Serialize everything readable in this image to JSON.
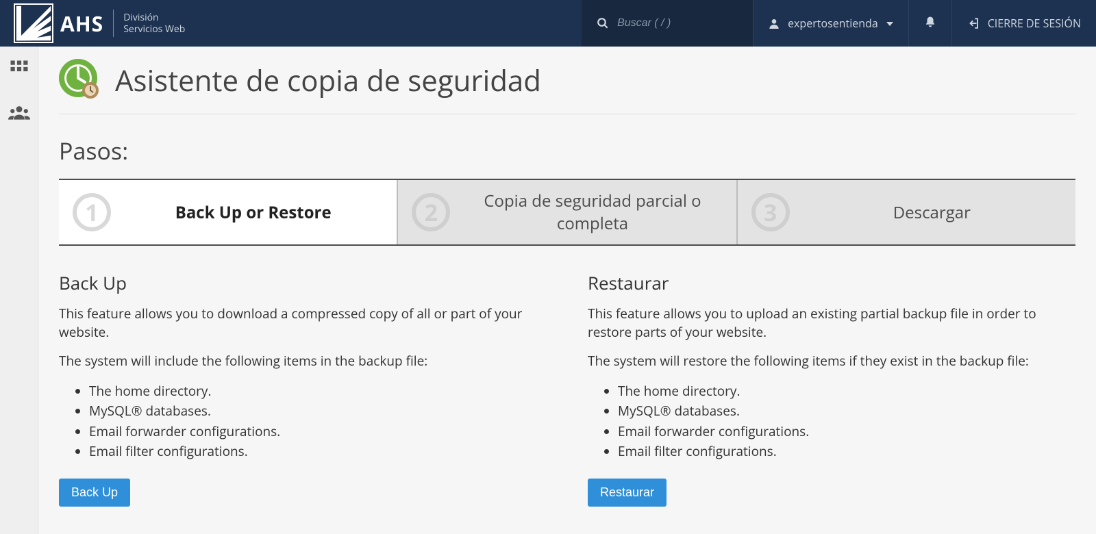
{
  "brand": {
    "main": "AHS",
    "sub1": "División",
    "sub2": "Servicios Web"
  },
  "nav": {
    "search_placeholder": "Buscar ( / )",
    "user": "expertosentienda",
    "logout": "CIERRE DE SESIÓN"
  },
  "page": {
    "title": "Asistente de copia de seguridad",
    "steps_heading": "Pasos:"
  },
  "steps": [
    {
      "num": "1",
      "label": "Back Up or Restore",
      "active": true
    },
    {
      "num": "2",
      "label": "Copia de seguridad parcial o completa",
      "active": false
    },
    {
      "num": "3",
      "label": "Descargar",
      "active": false
    }
  ],
  "backup": {
    "heading": "Back Up",
    "desc": "This feature allows you to download a compressed copy of all or part of your website.",
    "list_intro": "The system will include the following items in the backup file:",
    "items": [
      "The home directory.",
      "MySQL® databases.",
      "Email forwarder configurations.",
      "Email filter configurations."
    ],
    "button": "Back Up"
  },
  "restore": {
    "heading": "Restaurar",
    "desc": "This feature allows you to upload an existing partial backup file in order to restore parts of your website.",
    "list_intro": "The system will restore the following items if they exist in the backup file:",
    "items": [
      "The home directory.",
      "MySQL® databases.",
      "Email forwarder configurations.",
      "Email filter configurations."
    ],
    "button": "Restaurar"
  }
}
